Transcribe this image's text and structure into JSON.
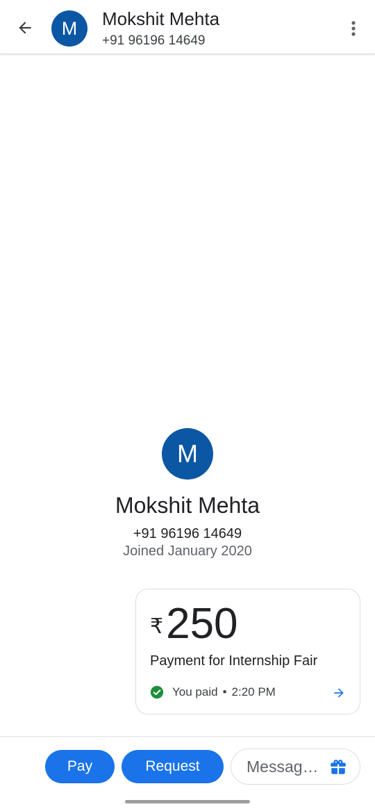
{
  "header": {
    "back_icon": "arrow-left-icon",
    "avatar_initial": "M",
    "name": "Mokshit Mehta",
    "phone": "+91 96196 14649",
    "more_icon": "more-vertical-icon"
  },
  "profile": {
    "avatar_initial": "M",
    "name": "Mokshit Mehta",
    "phone": "+91 96196 14649",
    "joined": "Joined January 2020"
  },
  "payment": {
    "currency_symbol": "₹",
    "amount": "250",
    "note": "Payment for Internship Fair",
    "status": "You paid",
    "separator": "•",
    "time": "2:20 PM",
    "status_icon": "check-circle-icon",
    "arrow_icon": "arrow-right-icon"
  },
  "bottom_bar": {
    "pay_label": "Pay",
    "request_label": "Request",
    "message_placeholder": "Messag…",
    "gift_icon": "gift-icon"
  },
  "colors": {
    "avatar": "#0b57a4",
    "primary_button": "#1a73e8",
    "success": "#1e8e3e",
    "link": "#1a73e8"
  }
}
